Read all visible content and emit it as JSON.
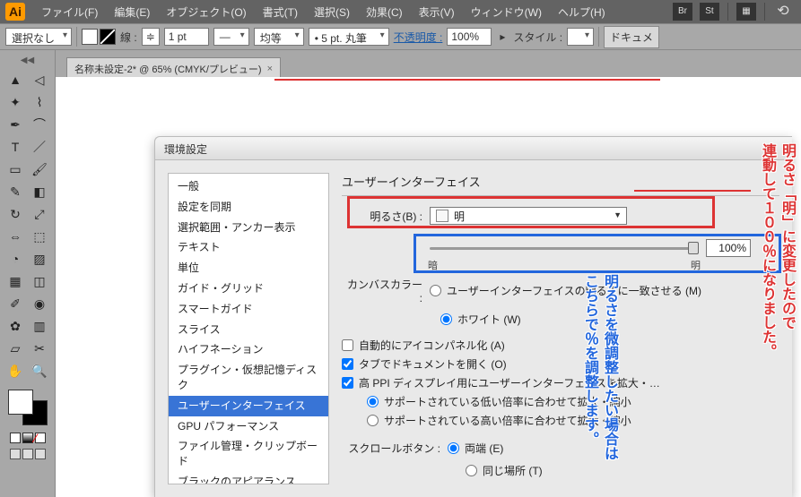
{
  "menubar": {
    "logo": "Ai",
    "items": [
      "ファイル(F)",
      "編集(E)",
      "オブジェクト(O)",
      "書式(T)",
      "選択(S)",
      "効果(C)",
      "表示(V)",
      "ウィンドウ(W)",
      "ヘルプ(H)"
    ],
    "right_icons": [
      "Br",
      "St"
    ]
  },
  "optbar": {
    "selection": "選択なし",
    "stroke_label": "線 :",
    "stroke_width": "1 pt",
    "uniform": "均等",
    "brush": "5 pt. 丸筆",
    "opacity_label": "不透明度 :",
    "opacity_value": "100%",
    "style_label": "スタイル :",
    "doc_btn": "ドキュメ"
  },
  "doc": {
    "tab_title": "名称未設定-2* @ 65% (CMYK/プレビュー)",
    "tab_close": "×"
  },
  "pref": {
    "title": "環境設定",
    "categories": [
      "一般",
      "設定を同期",
      "選択範囲・アンカー表示",
      "テキスト",
      "単位",
      "ガイド・グリッド",
      "スマートガイド",
      "スライス",
      "ハイフネーション",
      "プラグイン・仮想記憶ディスク",
      "ユーザーインターフェイス",
      "GPU パフォーマンス",
      "ファイル管理・クリップボード",
      "ブラックのアピアランス"
    ],
    "selected_index": 10,
    "section": "ユーザーインターフェイス",
    "brightness_label": "明るさ(B) :",
    "brightness_value": "明",
    "slider_dark": "暗",
    "slider_light": "明",
    "percent": "100%",
    "canvas_label": "カンバスカラー :",
    "canvas_opt1": "ユーザーインターフェイスの明るさに一致させる (M)",
    "canvas_opt2": "ホワイト (W)",
    "auto_iconize": "自動的にアイコンパネル化 (A)",
    "open_tabs": "タブでドキュメントを開く (O)",
    "hi_ppi": "高 PPI ディスプレイ用にユーザーインターフェイスを拡大・…",
    "hi_ppi_opt1": "サポートされている低い倍率に合わせて拡大・縮小",
    "hi_ppi_opt2": "サポートされている高い倍率に合わせて拡大・縮小",
    "scroll_label": "スクロールボタン :",
    "scroll_opt1": "両端 (E)",
    "scroll_opt2": "同じ場所 (T)"
  },
  "notes": {
    "red1": "明るさ「明」に変更したので",
    "red2": "連動して１００％になりました。",
    "blue1": "明るさを微調整したい場合は",
    "blue2": "こちらで％を調整します。"
  }
}
